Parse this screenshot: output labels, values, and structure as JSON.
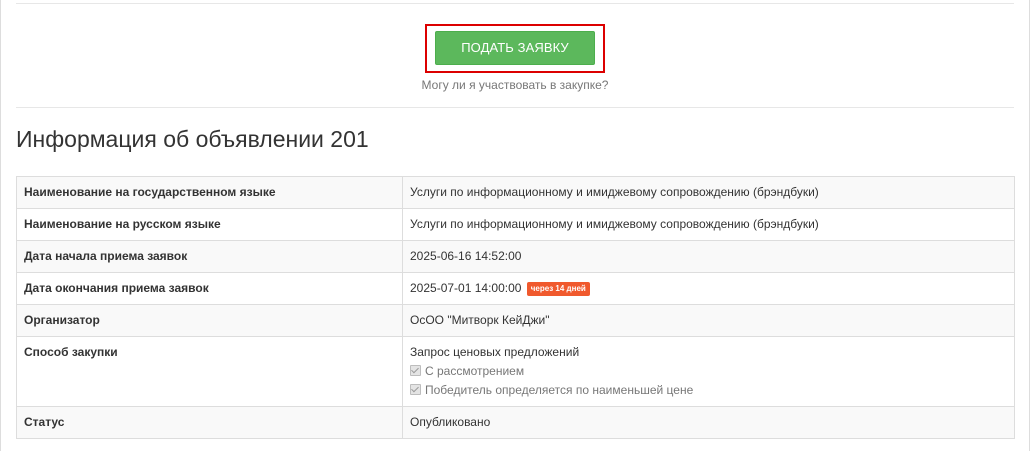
{
  "apply": {
    "button_label": "ПОДАТЬ ЗАЯВКУ",
    "eligibility_link": "Могу ли я участвовать в закупке?"
  },
  "announcement": {
    "title": "Информация об объявлении 201"
  },
  "details": {
    "rows": [
      {
        "label": "Наименование на государственном языке",
        "value": "Услуги по информационному и имиджевому сопровождению (брэндбуки)"
      },
      {
        "label": "Наименование на русском языке",
        "value": "Услуги по информационному и имиджевому сопровождению (брэндбуки)"
      },
      {
        "label": "Дата начала приема заявок",
        "value": "2025-06-16 14:52:00"
      },
      {
        "label": "Дата окончания приема заявок",
        "value": "2025-07-01 14:00:00",
        "badge": "через 14 дней"
      },
      {
        "label": "Организатор",
        "value": "ОсОО \"Митворк КейДжи\""
      },
      {
        "label": "Способ закупки",
        "value": "Запрос ценовых предложений",
        "options": [
          {
            "label": "С рассмотрением",
            "checked": true
          },
          {
            "label": "Победитель определяется по наименьшей цене",
            "checked": true
          }
        ]
      },
      {
        "label": "Статус",
        "value": "Опубликовано"
      }
    ]
  },
  "colors": {
    "apply_button": "#5cb85c",
    "highlight_frame": "#dc0000",
    "deadline_badge": "#f0592d"
  }
}
